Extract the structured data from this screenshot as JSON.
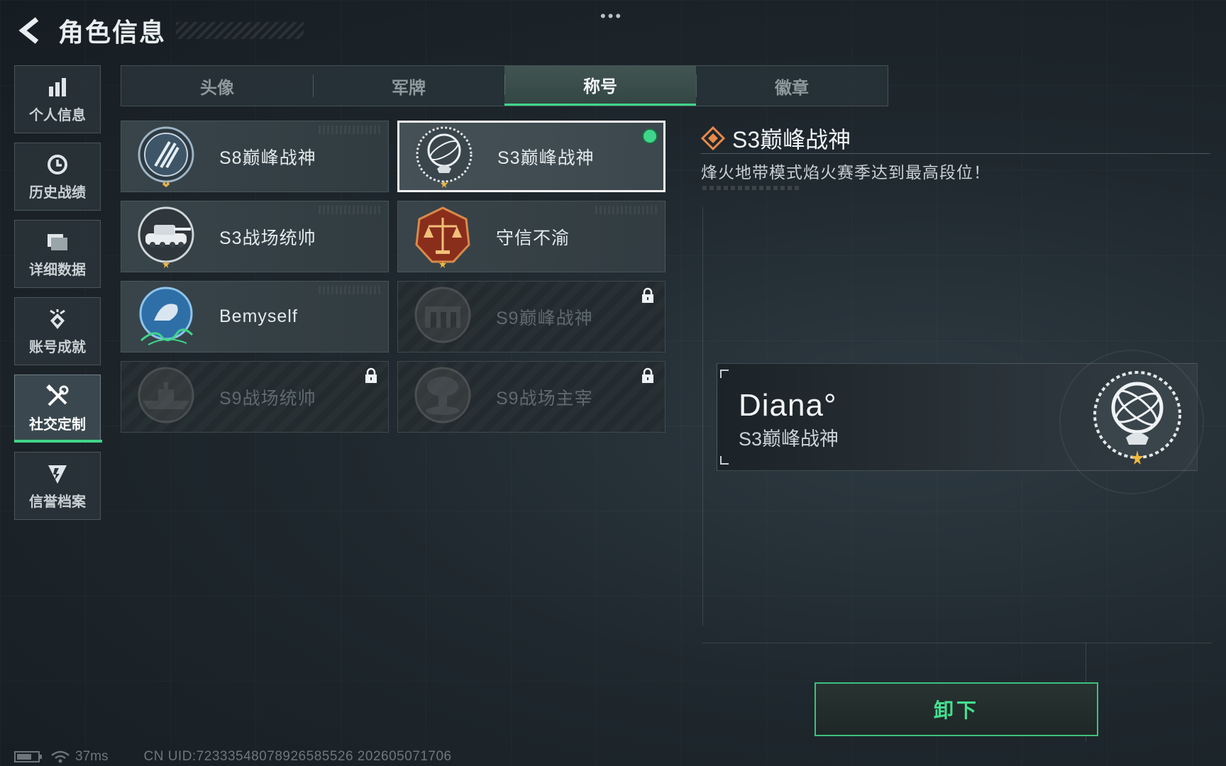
{
  "header": {
    "title": "角色信息"
  },
  "sidebar": {
    "items": [
      {
        "label": "个人信息",
        "icon": "bar-chart-icon"
      },
      {
        "label": "历史战绩",
        "icon": "clock-icon"
      },
      {
        "label": "详细数据",
        "icon": "folder-icon"
      },
      {
        "label": "账号成就",
        "icon": "achievement-icon"
      },
      {
        "label": "社交定制",
        "icon": "tools-icon",
        "active": true
      },
      {
        "label": "信誉档案",
        "icon": "shield-icon"
      }
    ]
  },
  "tabs": [
    {
      "label": "头像"
    },
    {
      "label": "军牌"
    },
    {
      "label": "称号",
      "active": true
    },
    {
      "label": "徽章"
    }
  ],
  "titles": [
    {
      "label": "S8巅峰战神",
      "badge": "s8-peak-badge-icon",
      "state": "owned"
    },
    {
      "label": "S3巅峰战神",
      "badge": "s3-peak-badge-icon",
      "state": "equipped"
    },
    {
      "label": "S3战场统帅",
      "badge": "tank-badge-icon",
      "state": "owned"
    },
    {
      "label": "守信不渝",
      "badge": "scales-badge-icon",
      "state": "owned"
    },
    {
      "label": "Bemyself",
      "badge": "signature-badge-icon",
      "state": "owned"
    },
    {
      "label": "S9巅峰战神",
      "badge": "fortress-badge-icon",
      "state": "locked"
    },
    {
      "label": "S9战场统帅",
      "badge": "ship-badge-icon",
      "state": "locked"
    },
    {
      "label": "S9战场主宰",
      "badge": "mushroom-cloud-badge-icon",
      "state": "locked"
    }
  ],
  "detail": {
    "title": "S3巅峰战神",
    "description": "烽火地带模式焰火赛季达到最高段位！"
  },
  "preview": {
    "player_name": "Diana°",
    "title": "S3巅峰战神"
  },
  "actions": {
    "unequip_label": "卸下"
  },
  "status": {
    "ping": "37ms",
    "uid": "CN UID:72333548078926585526 202605071706"
  },
  "colors": {
    "accent_green": "#3fd58a",
    "background": "#1f282e"
  }
}
